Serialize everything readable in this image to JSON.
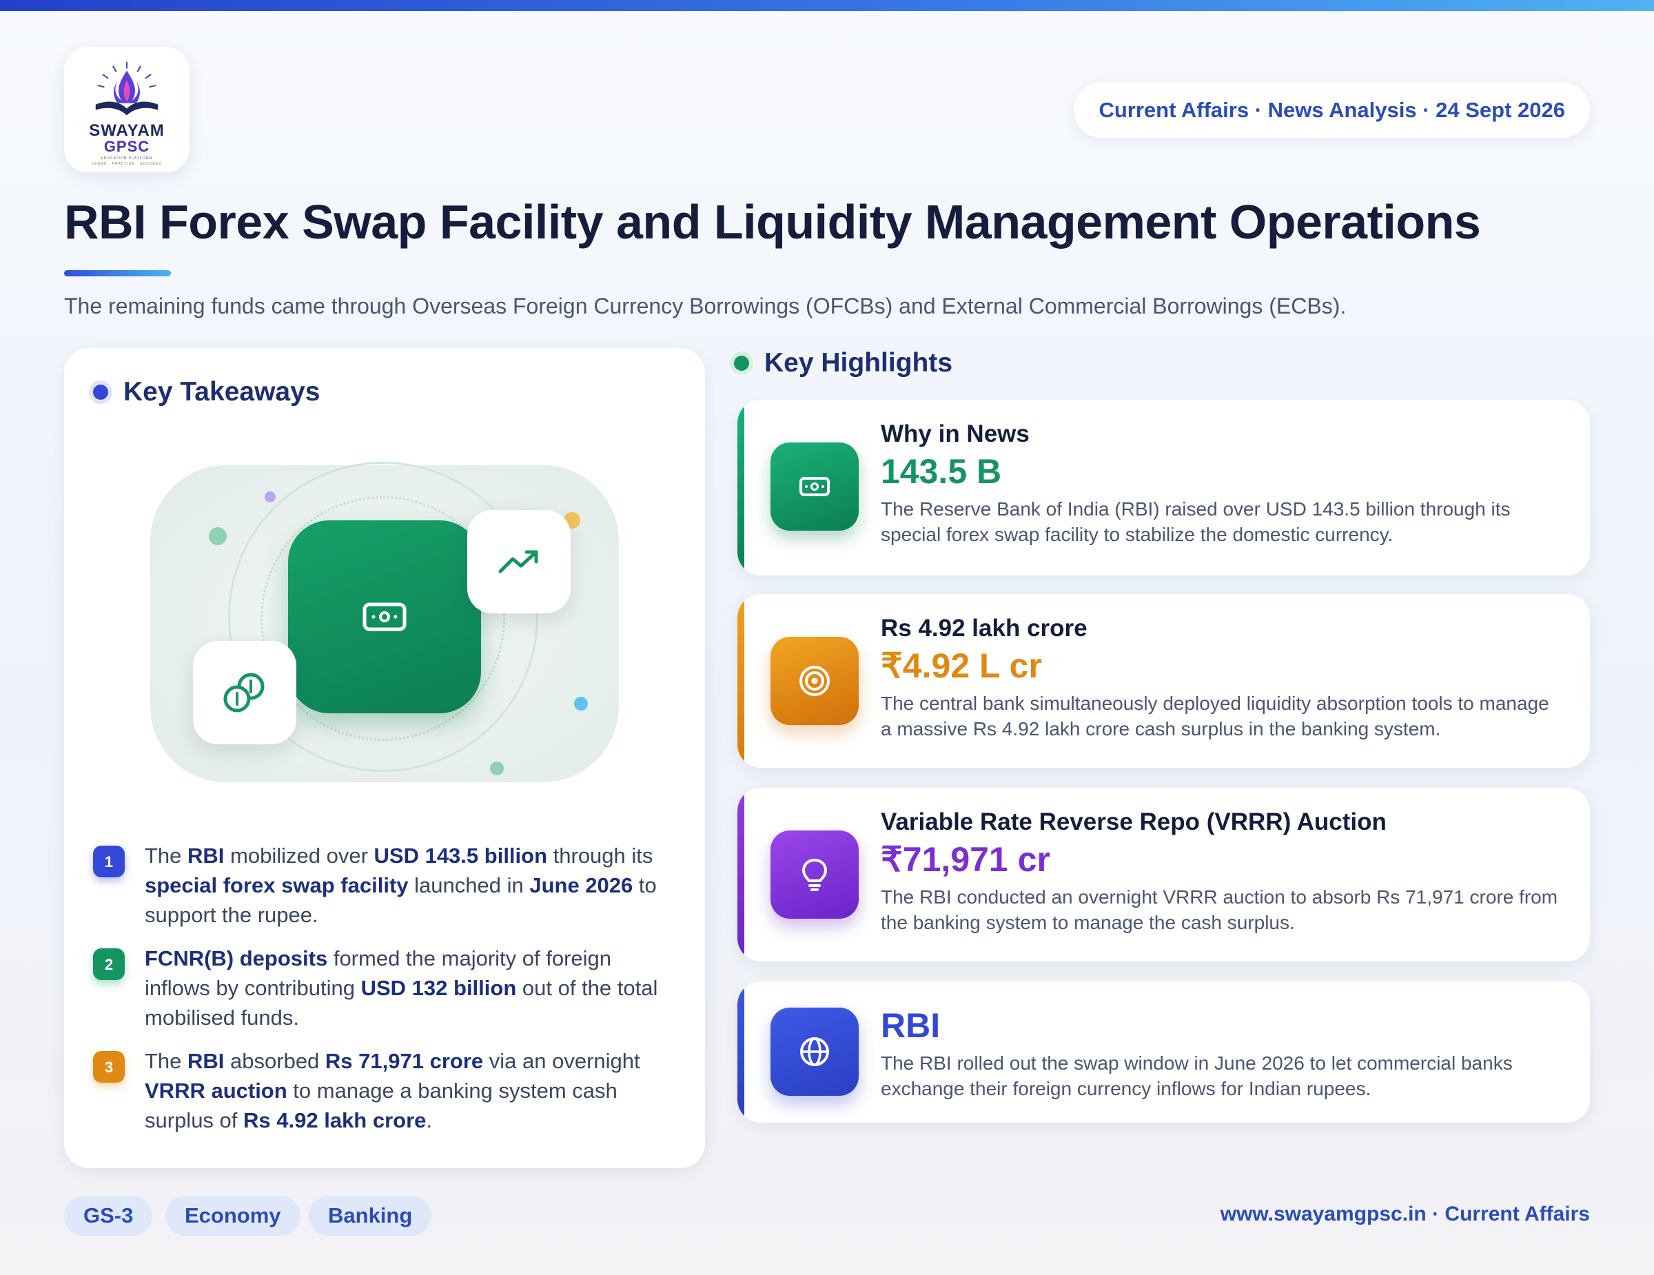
{
  "brand": {
    "name_line1": "SWAYAM",
    "name_line2": "GPSC",
    "tagline": "EDUCATION PLATFORM",
    "motto": "LEARN · PRACTICE · SUCCEED"
  },
  "header": {
    "date_pill": "Current Affairs · News Analysis · 24 Sept 2026",
    "title": "RBI Forex Swap Facility and Liquidity Management Operations",
    "subtitle": "The remaining funds came through Overseas Foreign Currency Borrowings (OFCBs) and External Commercial Borrowings (ECBs)."
  },
  "takeaways": {
    "heading": "Key Takeaways",
    "items": [
      {
        "number": "1",
        "color": "#3448d8",
        "segments": [
          {
            "t": "The ",
            "b": false
          },
          {
            "t": "RBI",
            "b": true
          },
          {
            "t": " mobilized over ",
            "b": false
          },
          {
            "t": "USD 143.5 billion",
            "b": true
          },
          {
            "t": " through its ",
            "b": false
          },
          {
            "t": "special forex swap facility",
            "b": true
          },
          {
            "t": " launched in ",
            "b": false
          },
          {
            "t": "June 2026",
            "b": true
          },
          {
            "t": " to support the rupee.",
            "b": false
          }
        ]
      },
      {
        "number": "2",
        "color": "#14955f",
        "segments": [
          {
            "t": "FCNR(B) deposits",
            "b": true
          },
          {
            "t": " formed the majority of foreign inflows by contributing ",
            "b": false
          },
          {
            "t": "USD 132 billion",
            "b": true
          },
          {
            "t": " out of the total mobilised funds.",
            "b": false
          }
        ]
      },
      {
        "number": "3",
        "color": "#e08a14",
        "segments": [
          {
            "t": "The ",
            "b": false
          },
          {
            "t": "RBI",
            "b": true
          },
          {
            "t": " absorbed ",
            "b": false
          },
          {
            "t": "Rs 71,971 crore",
            "b": true
          },
          {
            "t": " via an overnight ",
            "b": false
          },
          {
            "t": "VRRR auction",
            "b": true
          },
          {
            "t": " to manage a banking system cash surplus of ",
            "b": false
          },
          {
            "t": "Rs 4.92 lakh crore",
            "b": true
          },
          {
            "t": ".",
            "b": false
          }
        ]
      }
    ]
  },
  "highlights": {
    "heading": "Key Highlights",
    "cards": [
      {
        "title": "Why in News",
        "value": "143.5 B",
        "description": "The Reserve Bank of India (RBI) raised over USD 143.5 billion through its special forex swap facility to stabilize the domestic currency.",
        "icon": "banknote-icon",
        "color": "#14955f"
      },
      {
        "title": "Rs 4.92 lakh crore",
        "value": "₹4.92 L cr",
        "description": "The central bank simultaneously deployed liquidity absorption tools to manage a massive Rs 4.92 lakh crore cash surplus in the banking system.",
        "icon": "target-icon",
        "color": "#e08a14"
      },
      {
        "title": "Variable Rate Reverse Repo (VRRR) Auction",
        "value": "₹71,971 cr",
        "description": "The RBI conducted an overnight VRRR auction to absorb Rs 71,971 crore from the banking system to manage the cash surplus.",
        "icon": "lightbulb-icon",
        "color": "#7d33d6"
      },
      {
        "title": "",
        "value": "RBI",
        "description": "The RBI rolled out the swap window in June 2026 to let commercial banks exchange their foreign currency inflows for Indian rupees.",
        "icon": "globe-icon",
        "color": "#3448d8"
      }
    ]
  },
  "tags": [
    "GS-3",
    "Economy",
    "Banking"
  ],
  "footer": {
    "site": "www.swayamgpsc.in · Current Affairs"
  }
}
